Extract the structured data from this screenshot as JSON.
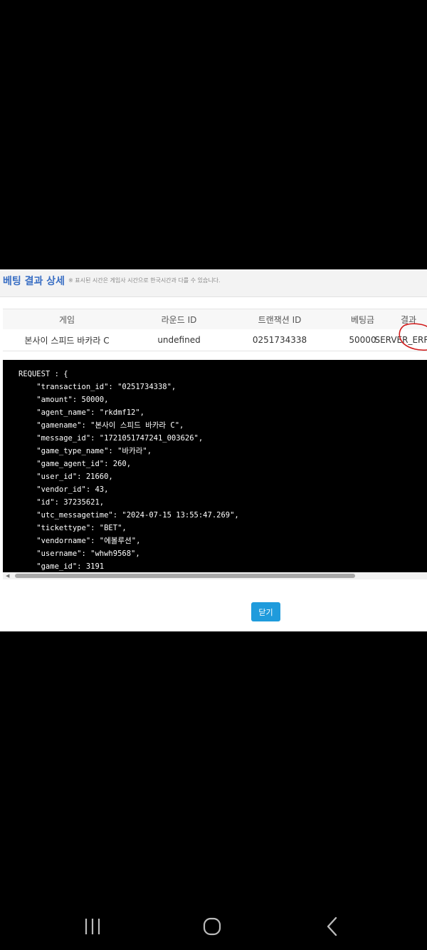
{
  "modal": {
    "title": "베팅 결과 상세",
    "note": "※ 표시된 시간은 게임사 시간으로 한국시간과 다를 수 있습니다."
  },
  "table": {
    "headers": {
      "game": "게임",
      "round_id": "라운드 ID",
      "transaction_id": "트랜잭션 ID",
      "bet_amount": "베팅금",
      "result": "결과"
    },
    "row": {
      "game": "본사이 스피드 바카라 C",
      "round_id": "undefined",
      "transaction_id": "0251734338",
      "bet_amount": "50000",
      "result": "SERVER_ERROR"
    }
  },
  "request_json": "REQUEST : {\n    \"transaction_id\": \"0251734338\",\n    \"amount\": 50000,\n    \"agent_name\": \"rkdmf12\",\n    \"gamename\": \"본사이 스피드 바카라 C\",\n    \"message_id\": \"1721051747241_003626\",\n    \"game_type_name\": \"바카라\",\n    \"game_agent_id\": 260,\n    \"user_id\": 21660,\n    \"vendor_id\": 43,\n    \"id\": 37235621,\n    \"utc_messagetime\": \"2024-07-15 13:55:47.269\",\n    \"tickettype\": \"BET\",\n    \"vendorname\": \"에볼루션\",\n    \"username\": \"whwh9568\",\n    \"game_id\": 3191\n}",
  "footer": {
    "close_label": "닫기"
  },
  "navigation": {
    "recent_apps": "recent-apps-icon",
    "home": "home-icon",
    "back": "back-icon"
  },
  "colors": {
    "title": "#3a6fc4",
    "close_button": "#1f9bdc",
    "error_mark": "#d11a1a"
  }
}
